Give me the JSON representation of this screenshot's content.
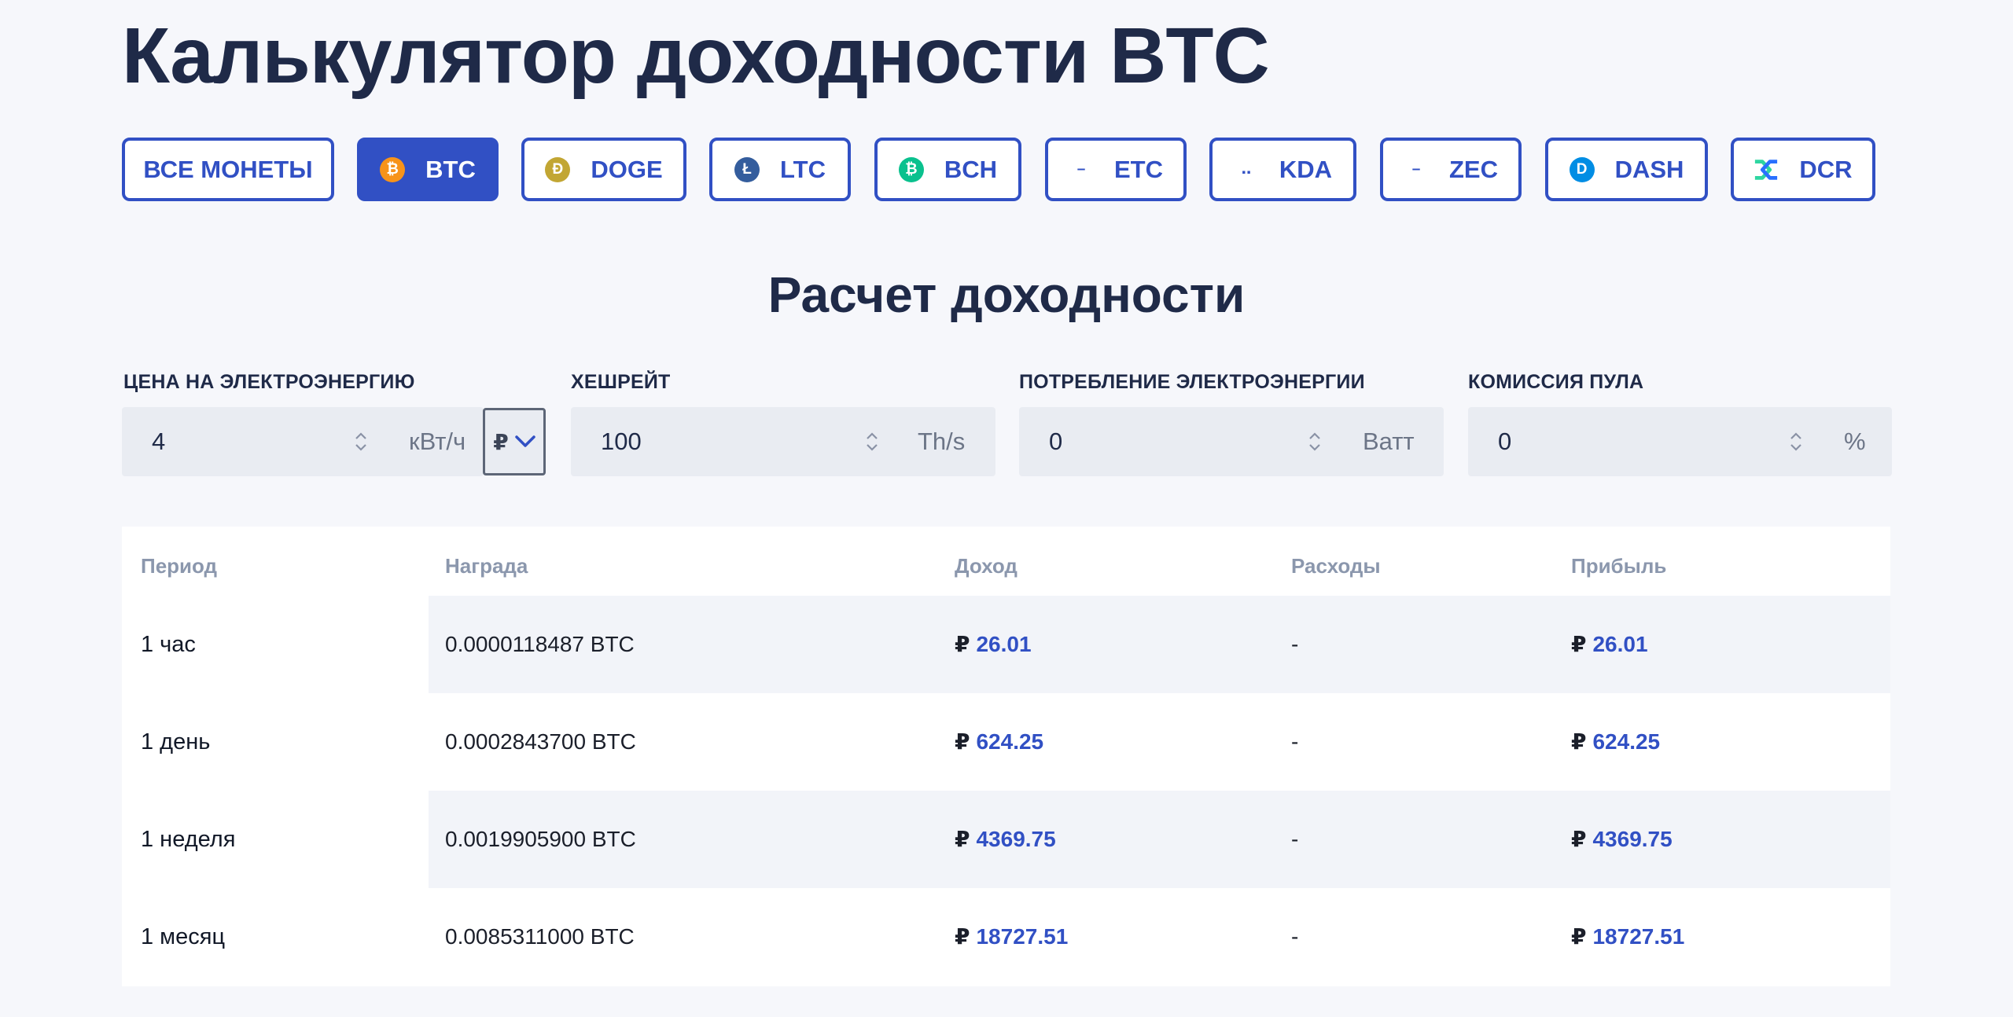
{
  "title": "Калькулятор доходности BTC",
  "coins": [
    {
      "label": "ВСЕ МОНЕТЫ",
      "active": false,
      "icon": "none"
    },
    {
      "label": "BTC",
      "active": true,
      "icon": "bitcoin-icon",
      "color": "#f7931a",
      "glyph": "₿"
    },
    {
      "label": "DOGE",
      "active": false,
      "icon": "dogecoin-icon",
      "color": "#c2a633",
      "glyph": "Ð"
    },
    {
      "label": "LTC",
      "active": false,
      "icon": "litecoin-icon",
      "color": "#345d9d",
      "glyph": "Ł"
    },
    {
      "label": "BCH",
      "active": false,
      "icon": "bitcoin-cash-icon",
      "color": "#0ac18e",
      "glyph": "₿"
    },
    {
      "label": "ETC",
      "active": false,
      "icon": "etc-icon-placeholder",
      "glyph": "–"
    },
    {
      "label": "KDA",
      "active": false,
      "icon": "kda-icon-placeholder",
      "glyph": "‥"
    },
    {
      "label": "ZEC",
      "active": false,
      "icon": "zec-icon-placeholder",
      "glyph": "–"
    },
    {
      "label": "DASH",
      "active": false,
      "icon": "dash-icon",
      "color": "#008de4",
      "glyph": "D"
    },
    {
      "label": "DCR",
      "active": false,
      "icon": "decred-icon",
      "color": "#2ed6a1"
    }
  ],
  "section_title": "Расчет доходности",
  "fields": {
    "electricity": {
      "label": "ЦЕНА НА ЭЛЕКТРОЭНЕРГИЮ",
      "value": "4",
      "unit": "кВт/ч",
      "currency": "₽"
    },
    "hashrate": {
      "label": "ХЕШРЕЙТ",
      "value": "100",
      "unit": "Th/s"
    },
    "power": {
      "label": "ПОТРЕБЛЕНИЕ ЭЛЕКТРОЭНЕРГИИ",
      "value": "0",
      "unit": "Ватт"
    },
    "pool_fee": {
      "label": "КОМИССИЯ ПУЛА",
      "value": "0",
      "unit": "%"
    }
  },
  "table": {
    "headers": {
      "period": "Период",
      "reward": "Награда",
      "income": "Доход",
      "expenses": "Расходы",
      "profit": "Прибыль"
    },
    "currency_symbol": "₽",
    "rows": [
      {
        "period": "1 час",
        "reward": "0.0000118487 BTC",
        "income": "26.01",
        "expenses": "-",
        "profit": "26.01"
      },
      {
        "period": "1 день",
        "reward": "0.0002843700 BTC",
        "income": "624.25",
        "expenses": "-",
        "profit": "624.25"
      },
      {
        "period": "1 неделя",
        "reward": "0.0019905900 BTC",
        "income": "4369.75",
        "expenses": "-",
        "profit": "4369.75"
      },
      {
        "period": "1 месяц",
        "reward": "0.0085311000 BTC",
        "income": "18727.51",
        "expenses": "-",
        "profit": "18727.51"
      }
    ]
  }
}
